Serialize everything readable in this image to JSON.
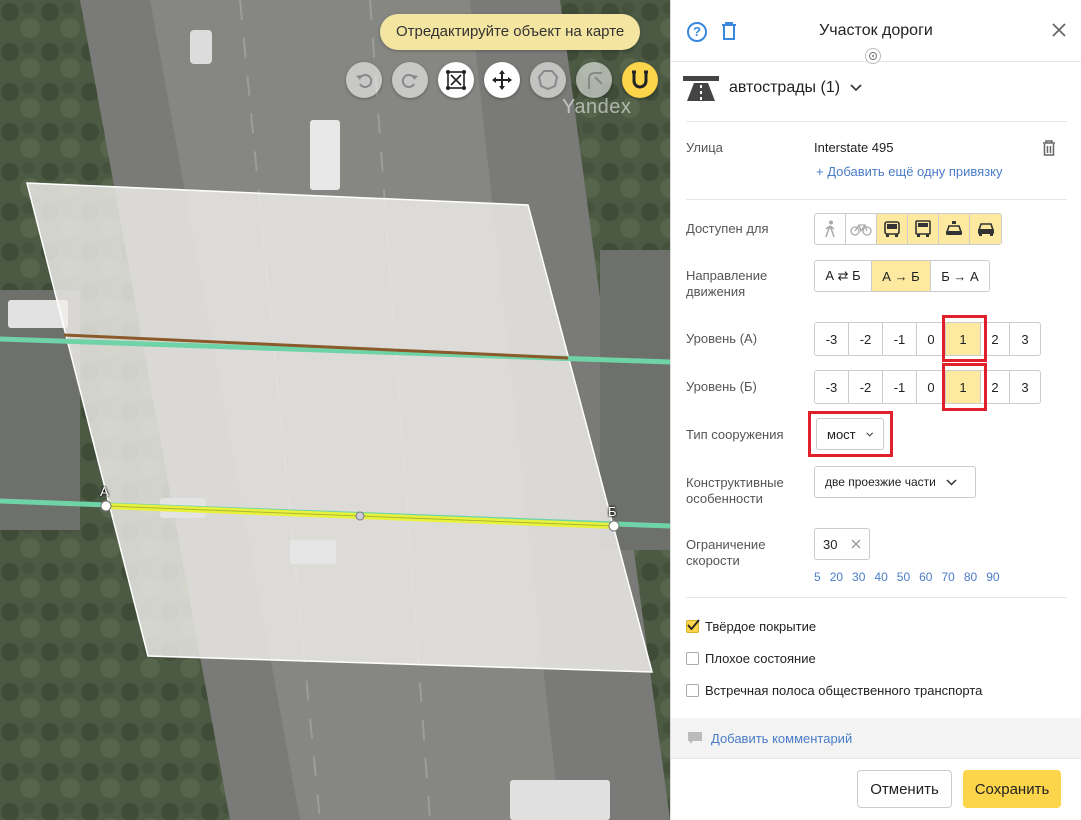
{
  "map": {
    "hint": "Отредактируйте объект на карте",
    "watermark": "Yandex",
    "tools": [
      "undo-icon",
      "redo-icon",
      "delete-vertex-icon",
      "move-icon",
      "polygon-icon",
      "cut-icon",
      "snap-magnet-icon"
    ],
    "point_a_label": "А",
    "point_b_label": "Б"
  },
  "panel": {
    "title": "Участок дороги",
    "category": "автострады (1)",
    "street": {
      "label": "Улица",
      "value": "Interstate 495",
      "add_link": "+ Добавить ещё одну привязку"
    },
    "access": {
      "label": "Доступен для",
      "options": [
        {
          "icon": "pedestrian-icon",
          "on": false
        },
        {
          "icon": "bicycle-icon",
          "on": false
        },
        {
          "icon": "bus-icon",
          "on": true
        },
        {
          "icon": "truck-icon",
          "on": true
        },
        {
          "icon": "taxi-icon",
          "on": true
        },
        {
          "icon": "car-icon",
          "on": true
        }
      ]
    },
    "direction": {
      "label": "Направление движения",
      "label_line1": "Направление",
      "label_line2": "движения",
      "options": [
        "А ⇄ Б",
        "А → Б",
        "Б → А"
      ],
      "selected": "А → Б"
    },
    "level_a": {
      "label": "Уровень (А)",
      "options": [
        "-3",
        "-2",
        "-1",
        "0",
        "1",
        "2",
        "3"
      ],
      "selected": "1"
    },
    "level_b": {
      "label": "Уровень (Б)",
      "options": [
        "-3",
        "-2",
        "-1",
        "0",
        "1",
        "2",
        "3"
      ],
      "selected": "1"
    },
    "structure": {
      "label": "Тип сооружения",
      "value": "мост"
    },
    "features": {
      "label_line1": "Конструктивные",
      "label_line2": "особенности",
      "value": "две проезжие части"
    },
    "speed": {
      "label_line1": "Ограничение",
      "label_line2": "скорости",
      "value": "30",
      "options": [
        "5",
        "20",
        "30",
        "40",
        "50",
        "60",
        "70",
        "80",
        "90"
      ]
    },
    "checks": [
      {
        "label": "Твёрдое покрытие",
        "checked": true
      },
      {
        "label": "Плохое состояние",
        "checked": false
      },
      {
        "label": "Встречная полоса общественного транспорта",
        "checked": false
      }
    ],
    "comment_link": "Добавить комментарий",
    "cancel": "Отменить",
    "save": "Сохранить"
  },
  "colors": {
    "accent_yellow": "#fcd54a",
    "selected_yellow": "#fdeaa0",
    "link_blue": "#4a7cc7",
    "highlight_red": "#e0202a",
    "road_green": "#6fd3a8"
  }
}
